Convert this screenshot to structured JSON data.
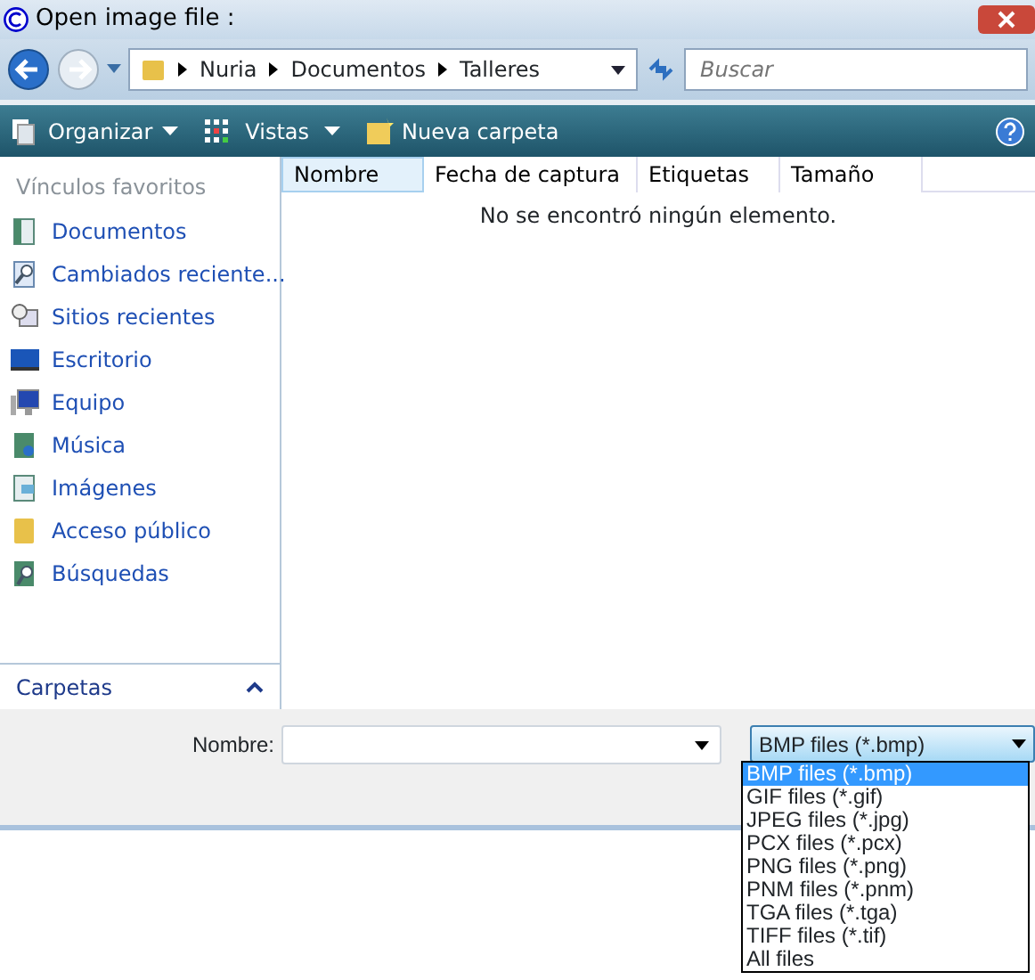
{
  "window": {
    "title": "Open image file :"
  },
  "address": {
    "crumbs": [
      "Nuria",
      "Documentos",
      "Talleres"
    ]
  },
  "search": {
    "placeholder": "Buscar"
  },
  "toolbar": [
    "Organizar",
    "Vistas",
    "Nueva carpeta"
  ],
  "sidebar": {
    "heading": "Vínculos favoritos",
    "items": [
      {
        "label": "Documentos"
      },
      {
        "label": "Cambiados reciente..."
      },
      {
        "label": "Sitios recientes"
      },
      {
        "label": "Escritorio"
      },
      {
        "label": "Equipo"
      },
      {
        "label": "Música"
      },
      {
        "label": "Imágenes"
      },
      {
        "label": "Acceso público"
      },
      {
        "label": "Búsquedas"
      }
    ],
    "folders": "Carpetas"
  },
  "table": {
    "columns": [
      {
        "label": "Nombre",
        "selected": true
      },
      {
        "label": "Fecha de captura",
        "selected": false
      },
      {
        "label": "Etiquetas",
        "selected": false
      },
      {
        "label": "Tamaño",
        "selected": false
      }
    ],
    "empty": "No se encontró ningún elemento."
  },
  "filename": {
    "label": "Nombre:"
  },
  "filetype": {
    "value": "BMP files (*.bmp)",
    "options": [
      {
        "label": "BMP files (*.bmp)",
        "selected": true
      },
      {
        "label": "GIF files (*.gif)",
        "selected": false
      },
      {
        "label": "JPEG files (*.jpg)",
        "selected": false
      },
      {
        "label": "PCX files (*.pcx)",
        "selected": false
      },
      {
        "label": "PNG files (*.png)",
        "selected": false
      },
      {
        "label": "PNM files (*.pnm)",
        "selected": false
      },
      {
        "label": "TGA files (*.tga)",
        "selected": false
      },
      {
        "label": "TIFF files (*.tif)",
        "selected": false
      },
      {
        "label": "All files",
        "selected": false
      }
    ]
  }
}
